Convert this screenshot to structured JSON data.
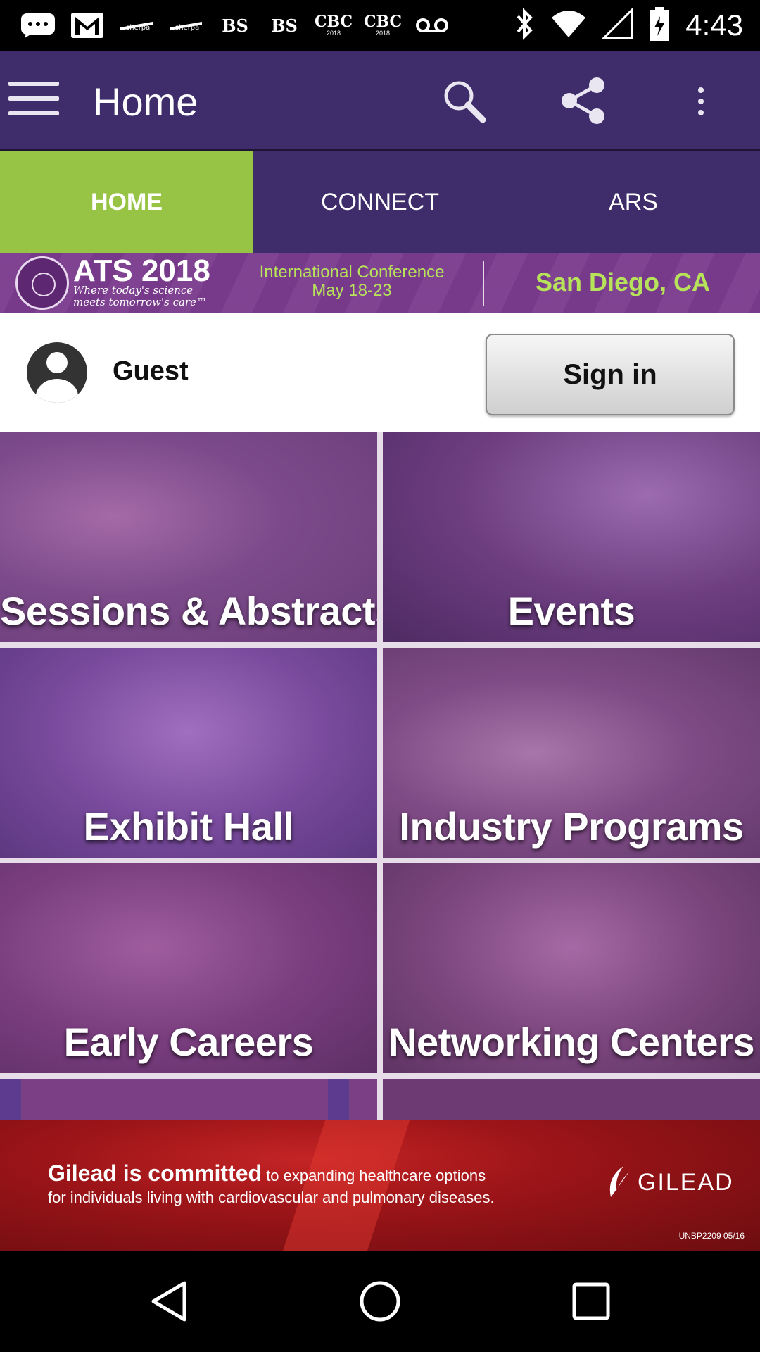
{
  "status_bar": {
    "left_icons": [
      "chat-bubble-icon",
      "gmail-icon",
      "sherpa-icon",
      "sherpa-icon",
      "bs-icon",
      "bs-icon",
      "cbc-icon",
      "cbc-icon",
      "voicemail-icon"
    ],
    "sherpa_text": "sherpa",
    "bs_text": "BS",
    "cbc_text": "CBC",
    "cbc_sub": "2018",
    "right_icons": [
      "bluetooth-icon",
      "wifi-icon",
      "signal-icon",
      "battery-icon"
    ],
    "time": "4:43"
  },
  "appbar": {
    "title": "Home",
    "actions": [
      "search-icon",
      "share-icon",
      "more-vert-icon"
    ]
  },
  "tabs": [
    {
      "label": "HOME",
      "active": true
    },
    {
      "label": "CONNECT",
      "active": false
    },
    {
      "label": "ARS",
      "active": false
    }
  ],
  "banner": {
    "title": "ATS 2018",
    "tagline": "Where today's science meets tomorrow's care™",
    "conference_line1": "International Conference",
    "conference_line2": "May 18-23",
    "location": "San Diego, CA"
  },
  "user": {
    "name": "Guest",
    "sign_in_label": "Sign in"
  },
  "tiles": [
    {
      "label": "Sessions & Abstracts"
    },
    {
      "label": "Events"
    },
    {
      "label": "Exhibit Hall"
    },
    {
      "label": "Industry Programs"
    },
    {
      "label": "Early Careers"
    },
    {
      "label": "Networking Centers"
    }
  ],
  "ad": {
    "headline_bold": "Gilead is committed",
    "headline_rest": " to expanding healthcare options",
    "line2": "for individuals living with cardiovascular and pulmonary diseases.",
    "brand": "GILEAD",
    "code": "UNBP2209   05/16"
  },
  "colors": {
    "appbar": "#3f2c6a",
    "tab_active": "#98c445",
    "banner": "#7b3b8e",
    "banner_accent": "#b7e35a",
    "ad_background": "#8e1116"
  }
}
